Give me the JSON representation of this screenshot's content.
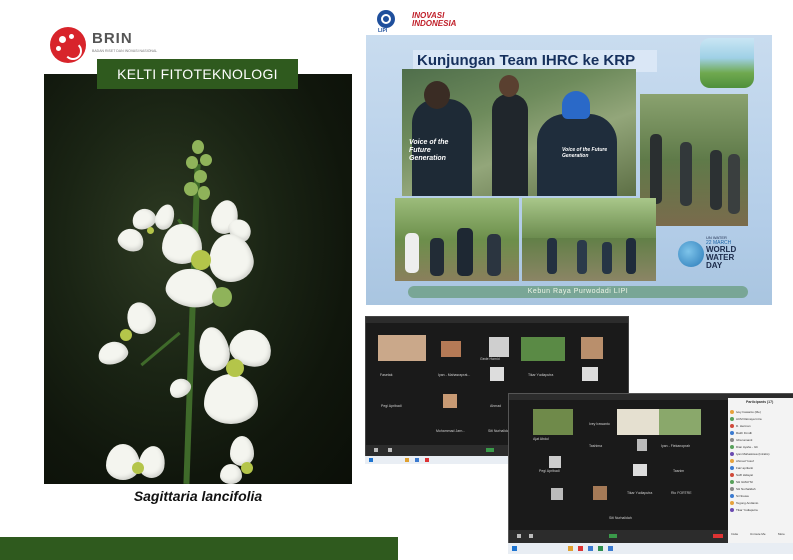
{
  "logo": {
    "name": "BRIN",
    "subtitle": "BADAN RISET DAN INOVASI NASIONAL",
    "color": "#d8242b"
  },
  "banner": {
    "text": "KELTI FITOTEKNOLOGI",
    "color": "#2f5a1e"
  },
  "caption": {
    "species": "Sagittaria lancifolia"
  },
  "poster": {
    "lipi_label": "LIPI",
    "inovasi_label": "INOVASI INDONESIA",
    "title": "Kunjungan Team IHRC ke KRP",
    "shirt_text": "Voice of the Future Generation",
    "wwd": {
      "top": "UN WATER",
      "date": "22 MARCH",
      "line1": "WORLD",
      "line2": "WATER",
      "line3": "DAY"
    },
    "footer": "Kebun Raya Purwodadi LIPI"
  },
  "zoom1": {
    "participants": [
      {
        "name": "Fasetak"
      },
      {
        "name": "Iyan - Mahasraprat..."
      },
      {
        "name": "Gede Hamid"
      },
      {
        "name": "Tikar Yudiaputra"
      },
      {
        "name": "Pegi Apribadi"
      },
      {
        "name": "Ahmad"
      },
      {
        "name": "Fadil..."
      },
      {
        "name": "Mohammad Jarn..."
      },
      {
        "name": "Siti Nurhalidah"
      }
    ]
  },
  "zoom2": {
    "participants": [
      {
        "name": "Ajat Abdul"
      },
      {
        "name": "Ivey Irawanto"
      },
      {
        "name": "Tashima"
      },
      {
        "name": "Iyan - Fiekanoprah"
      },
      {
        "name": "Pegi Apribadi"
      },
      {
        "name": "Tasnim"
      },
      {
        "name": "Tikar Yudiaputra"
      },
      {
        "name": "Rio FORTRE"
      },
      {
        "name": "Siti Nurhalidah"
      }
    ],
    "panel_title": "Participants (17)",
    "panel_list": [
      "Ivey Irawanto (Me)",
      "ACM Ratnaya Intra",
      "D. Herman",
      "Ratih Fimdli",
      "Icha tamanti",
      "Dian Ayahe - Gh",
      "Iyan Mahasiswa (Intrabs)",
      "Ahmad Yusuf",
      "Faiz aprilanti",
      "Soffi Hidayat",
      "Siti ILMAYNI",
      "Siti Nurhalidah",
      "Si Nisusa",
      "Tegong Andianto",
      "Tikar Yudiaputra"
    ],
    "panel_buttons": [
      "Invite",
      "Unmute Me",
      "More"
    ]
  },
  "colors": {
    "dark_green": "#2f5a1e",
    "zoom_bg": "#1a1a1a",
    "poster_blue": "#16305d"
  }
}
